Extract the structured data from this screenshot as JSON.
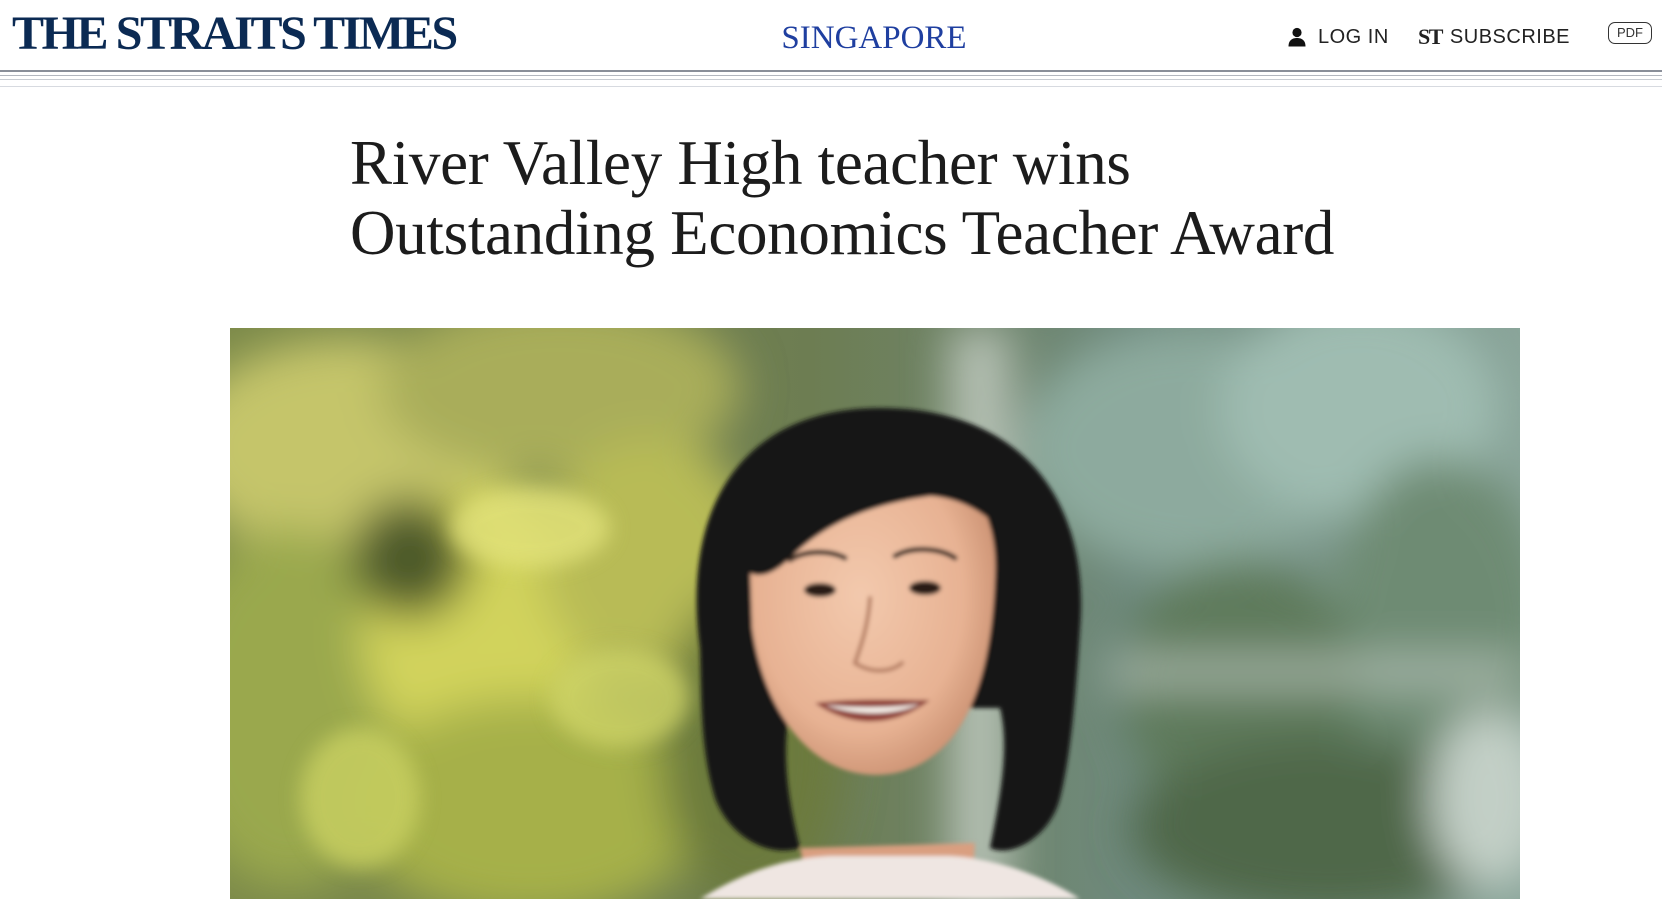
{
  "header": {
    "logo_text": "THE STRAITS TIMES",
    "section": "SINGAPORE",
    "login_label": "LOG IN",
    "subscribe_mark": "ST",
    "subscribe_label": "SUBSCRIBE",
    "pdf_label": "PDF"
  },
  "article": {
    "headline": "River Valley High teacher wins Outstanding Economics Teacher Award"
  },
  "icons": {
    "login": "user-icon",
    "subscribe": "st-logo-mark"
  },
  "colors": {
    "brand": "#0b2a53",
    "section_link": "#1f3fa0"
  }
}
